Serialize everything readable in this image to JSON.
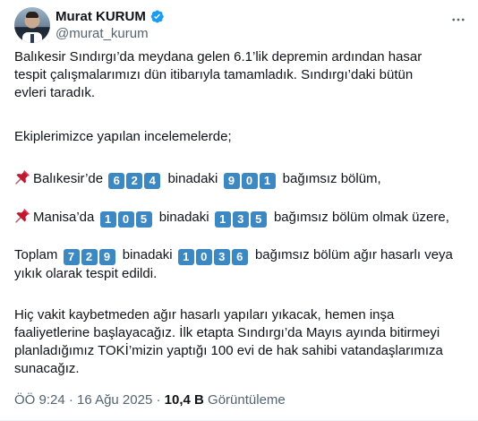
{
  "author": {
    "display_name": "Murat KURUM",
    "handle": "@murat_kurum",
    "verified_color": "#1d9bf0"
  },
  "tweet": {
    "line1": "Balıkesir Sındırgı’da meydana gelen 6.1’lik depremin ardından hasar",
    "line2": "tespit çalışmalarımızı dün itibarıyla tamamladık. Sındırgı’daki  bütün",
    "line3": "evleri taradık.",
    "line4": "Ekiplerimizce yapılan incelemelerde;",
    "b1": {
      "icon": "pushpin-icon",
      "prefix": "Balıkesir’de",
      "buildings": [
        "6",
        "2",
        "4"
      ],
      "mid": "binadaki",
      "units": [
        "9",
        "0",
        "1"
      ],
      "suffix": "bağımsız bölüm,"
    },
    "b2": {
      "icon": "pushpin-icon",
      "prefix": "Manisa’da",
      "buildings": [
        "1",
        "0",
        "5"
      ],
      "mid": "binadaki",
      "units": [
        "1",
        "3",
        "5"
      ],
      "suffix": "bağımsız bölüm olmak üzere,"
    },
    "total": {
      "prefix": "Toplam",
      "buildings": [
        "7",
        "2",
        "9"
      ],
      "mid": "binadaki",
      "units": [
        "1",
        "0",
        "3",
        "6"
      ],
      "suffix": "bağımsız bölüm ağır hasarlı veya",
      "line2": "yıkık olarak tespit edildi."
    },
    "p5_line1": "Hiç vakit kaybetmeden ağır hasarlı yapıları yıkacak, hemen inşa",
    "p5_line2": "faaliyetlerine başlayacağız. İlk etapta Sındırgı’da Mayıs ayında bitirmeyi",
    "p5_line3": "planladığımız TOKİ’mizin yaptığı 100 evi de hak sahibi vatandaşlarımıza",
    "p5_line4": "sunacağız."
  },
  "meta": {
    "time": "ÖÖ 9:24",
    "separator": "·",
    "date": "16 Ağu 2025",
    "views_count": "10,4 B",
    "views_label": "Görüntüleme"
  },
  "colors": {
    "keycap": "#3b88c3",
    "text": "#0f1419",
    "secondary": "#536471"
  }
}
